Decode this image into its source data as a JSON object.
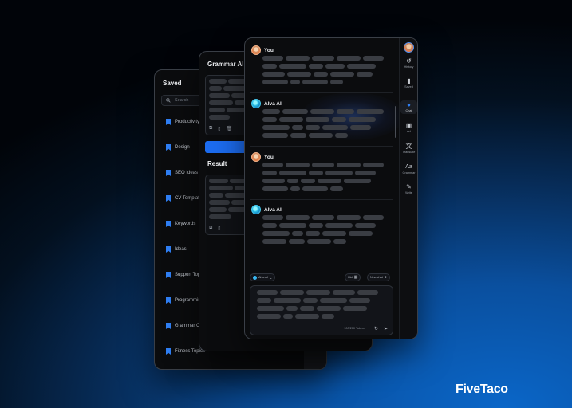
{
  "saved": {
    "title": "Saved",
    "search_placeholder": "Search",
    "items": [
      {
        "label": "Productivity"
      },
      {
        "label": "Design"
      },
      {
        "label": "SEO Ideas"
      },
      {
        "label": "CV Templat"
      },
      {
        "label": "Keywords"
      },
      {
        "label": "Ideas"
      },
      {
        "label": "Support Top"
      },
      {
        "label": "Programmir"
      },
      {
        "label": "Grammar Co"
      },
      {
        "label": "Fitness Topics"
      }
    ]
  },
  "grammar": {
    "title": "Grammar AI",
    "result_title": "Result"
  },
  "chat": {
    "messages": [
      {
        "sender": "You"
      },
      {
        "sender": "Alva AI"
      },
      {
        "sender": "You"
      },
      {
        "sender": "Alva AI"
      }
    ],
    "model_chip": "Alva AI",
    "hide_chip": "Hid",
    "new_chat_chip": "New chat",
    "tokens": "100/200 Tokens"
  },
  "sidebar": {
    "items": [
      {
        "label": "History",
        "icon": "history-icon"
      },
      {
        "label": "Saved",
        "icon": "bookmark-icon"
      },
      {
        "label": "Chat",
        "icon": "chat-icon"
      },
      {
        "label": "Art",
        "icon": "image-icon"
      },
      {
        "label": "Translate",
        "icon": "translate-icon"
      },
      {
        "label": "Grammar",
        "icon": "grammar-icon"
      },
      {
        "label": "Write",
        "icon": "pen-icon"
      }
    ]
  },
  "brand": "FiveTaco",
  "colors": {
    "accent": "#2f7ff5",
    "button": "#1c6cf0"
  }
}
